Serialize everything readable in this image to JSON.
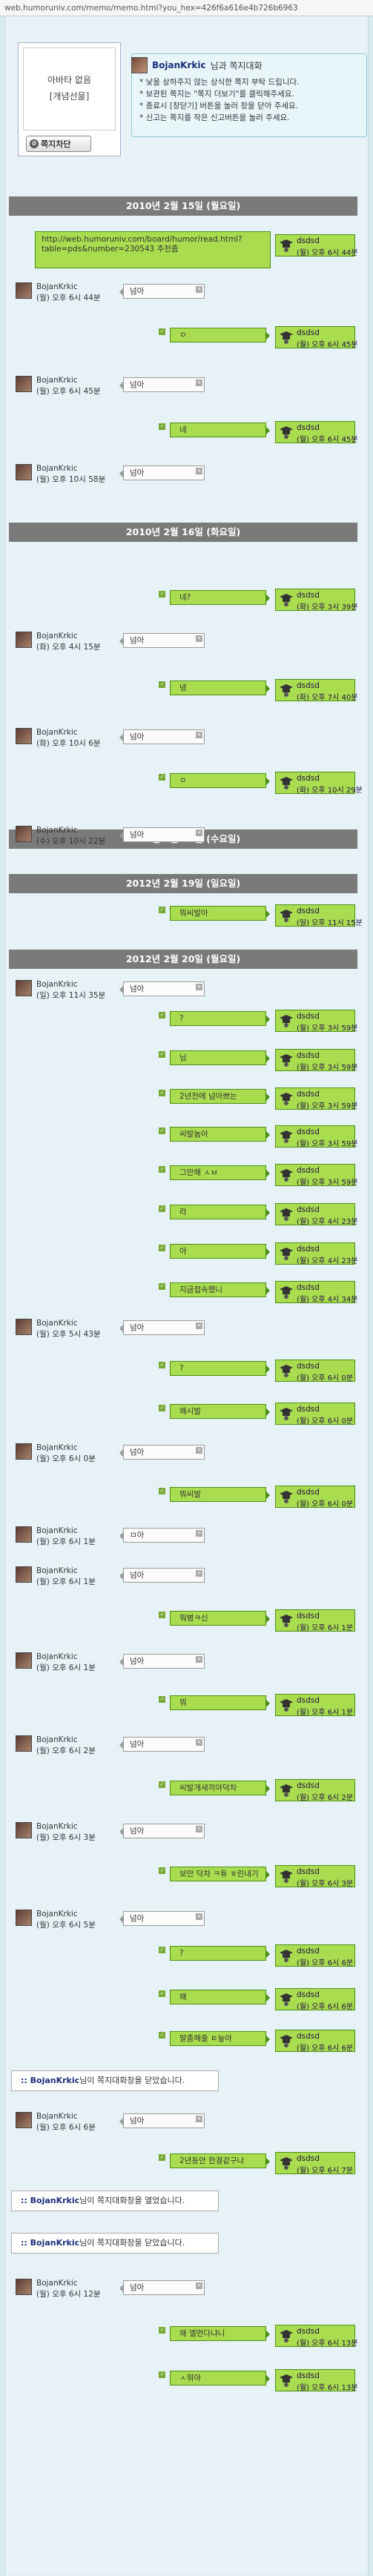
{
  "url": "web.humoruniv.com/memo/memo.html?you_hex=426f6a616e4b726b6963",
  "profile": {
    "text1": "아바타 없음",
    "text2": "[개념선물]",
    "block_button": "쪽지차단"
  },
  "info": {
    "title_user": "BojanKrkic",
    "title_suffix": "님과 쪽지대화",
    "lines": [
      "* 낯을 상하주지 않는 상식한 쪽지 부탁 드립니다.",
      "* 보관된 쪽지는 \"쪽지 더보기\"를 클릭해주세요.",
      "* 종료시 [창닫기] 버튼을 눌러 창을 닫아 주세요.",
      "* 신고는 쪽지를 작은 신고버튼을 눌러 주세요."
    ]
  },
  "dates": [
    {
      "label": "2010년 2월 15일 (월요일)"
    },
    {
      "label": "2010년 2월 16일 (화요일)"
    },
    {
      "label": "2010년 2월 17일 (수요일)"
    },
    {
      "label": "2012년 2월 19일 (일요일)"
    },
    {
      "label": "2012년 2월 20일 (월요일)"
    }
  ],
  "url_message": {
    "text": "http://web.humoruniv.com/board/humor/read.html?table=pds&number=230543 추천좀"
  },
  "messages": [
    {
      "side": "r",
      "text": "",
      "name": "dsdsd",
      "time": "(월) 오후 6시 44분"
    },
    {
      "side": "l",
      "text": "넘아",
      "name": "BojanKrkic",
      "time": "(월) 오후 6시 44분"
    },
    {
      "side": "r",
      "text": "ㅇ",
      "name": "dsdsd",
      "time": "(월) 오후 6시 45분"
    },
    {
      "side": "l",
      "text": "넘아",
      "name": "BojanKrkic",
      "time": "(월) 오후 6시 45분"
    },
    {
      "side": "r",
      "text": "네",
      "name": "dsdsd",
      "time": "(월) 오후 6시 45분"
    },
    {
      "side": "l",
      "text": "넘아",
      "name": "BojanKrkic",
      "time": "(월) 오후 10시 58분"
    },
    {
      "side": "r",
      "text": "네?",
      "name": "dsdsd",
      "time": "(화) 오후 3시 39분"
    },
    {
      "side": "l",
      "text": "넘아",
      "name": "BojanKrkic",
      "time": "(화) 오후 4시 15분"
    },
    {
      "side": "r",
      "text": "넹",
      "name": "dsdsd",
      "time": "(화) 오후 7시 40분"
    },
    {
      "side": "l",
      "text": "넘아",
      "name": "BojanKrkic",
      "time": "(화) 오후 10시 6분"
    },
    {
      "side": "r",
      "text": "ㅇ",
      "name": "dsdsd",
      "time": "(화) 오후 10시 29분"
    },
    {
      "side": "l",
      "text": "넘아",
      "name": "BojanKrkic",
      "time": "(수) 오후 10시 22분"
    },
    {
      "side": "r",
      "text": "뭐씨발아",
      "name": "dsdsd",
      "time": "(일) 오후 11시 15분"
    },
    {
      "side": "l",
      "text": "넘아",
      "name": "BojanKrkic",
      "time": "(일) 오후 11시 35분"
    },
    {
      "side": "r",
      "text": "?",
      "name": "dsdsd",
      "time": "(월) 오후 3시 59분"
    },
    {
      "side": "r",
      "text": "님",
      "name": "dsdsd",
      "time": "(월) 오후 3시 59분"
    },
    {
      "side": "r",
      "text": "2년전에 넘아쁘는",
      "name": "dsdsd",
      "time": "(월) 오후 3시 59분"
    },
    {
      "side": "r",
      "text": "씨발놈아",
      "name": "dsdsd",
      "time": "(월) 오후 3시 59분"
    },
    {
      "side": "r",
      "text": "그만해 ㅅㅂ",
      "name": "dsdsd",
      "time": "(월) 오후 3시 59분"
    },
    {
      "side": "r",
      "text": "라",
      "name": "dsdsd",
      "time": "(월) 오후 4시 23분"
    },
    {
      "side": "r",
      "text": "아",
      "name": "dsdsd",
      "time": "(월) 오후 4시 23분"
    },
    {
      "side": "r",
      "text": "지금접속했니",
      "name": "dsdsd",
      "time": "(월) 오후 4시 34분"
    },
    {
      "side": "l",
      "text": "넘아",
      "name": "BojanKrkic",
      "time": "(월) 오후 5시 43분"
    },
    {
      "side": "r",
      "text": "?",
      "name": "dsdsd",
      "time": "(월) 오후 6시 0분"
    },
    {
      "side": "r",
      "text": "왜시발",
      "name": "dsdsd",
      "time": "(월) 오후 6시 0분"
    },
    {
      "side": "l",
      "text": "넘아",
      "name": "BojanKrkic",
      "time": "(월) 오후 6시 0분"
    },
    {
      "side": "r",
      "text": "뭐씨발",
      "name": "dsdsd",
      "time": "(월) 오후 6시 0분"
    },
    {
      "side": "l",
      "text": "ㅁ아",
      "name": "BojanKrkic",
      "time": "(월) 오후 6시 1분"
    },
    {
      "side": "l",
      "text": "넘아",
      "name": "BojanKrkic",
      "time": "(월) 오후 6시 1분"
    },
    {
      "side": "r",
      "text": "뭐병ㅋ신",
      "name": "dsdsd",
      "time": "(월) 오후 6시 1분"
    },
    {
      "side": "l",
      "text": "넘아",
      "name": "BojanKrkic",
      "time": "(월) 오후 6시 1분"
    },
    {
      "side": "r",
      "text": "뭐",
      "name": "dsdsd",
      "time": "(월) 오후 6시 1분"
    },
    {
      "side": "l",
      "text": "넘아",
      "name": "BojanKrkic",
      "time": "(월) 오후 6시 2분"
    },
    {
      "side": "r",
      "text": "씨발개새끼야덕차",
      "name": "dsdsd",
      "time": "(월) 오후 6시 2분"
    },
    {
      "side": "l",
      "text": "넘아",
      "name": "BojanKrkic",
      "time": "(월) 오후 6시 3분"
    },
    {
      "side": "r",
      "text": "보안 닥차 ㅋ튜 ㅎ린내기",
      "name": "dsdsd",
      "time": "(월) 오후 6시 3분"
    },
    {
      "side": "l",
      "text": "넘아",
      "name": "BojanKrkic",
      "time": "(월) 오후 6시 5분"
    },
    {
      "side": "r",
      "text": "?",
      "name": "dsdsd",
      "time": "(월) 오후 6시 6분"
    },
    {
      "side": "r",
      "text": "왜",
      "name": "dsdsd",
      "time": "(월) 오후 6시 6분"
    },
    {
      "side": "r",
      "text": "말좀해줄 ㅌ늪아",
      "name": "dsdsd",
      "time": "(월) 오후 6시 6분"
    },
    {
      "side": "s",
      "user": "BojanKrkic",
      "text": "님이 쪽지대화창을 닫았습니다."
    },
    {
      "side": "l",
      "text": "넘아",
      "name": "BojanKrkic",
      "time": "(월) 오후 6시 6분"
    },
    {
      "side": "r",
      "text": "2년동안 한결같구나",
      "name": "dsdsd",
      "time": "(월) 오후 6시 7분"
    },
    {
      "side": "s",
      "user": "BojanKrkic",
      "text": "님이 쪽지대화창을 열었습니다."
    },
    {
      "side": "s",
      "user": "BojanKrkic",
      "text": "님이 쪽지대화창을 닫았습니다."
    },
    {
      "side": "l",
      "text": "넘아",
      "name": "BojanKrkic",
      "time": "(월) 오후 6시 12분"
    },
    {
      "side": "r",
      "text": "왜 엘먼다냐니",
      "name": "dsdsd",
      "time": "(월) 오후 6시 13분"
    },
    {
      "side": "r",
      "text": "ㅅ뭐아",
      "name": "dsdsd",
      "time": "(월) 오후 6시 13분"
    }
  ]
}
